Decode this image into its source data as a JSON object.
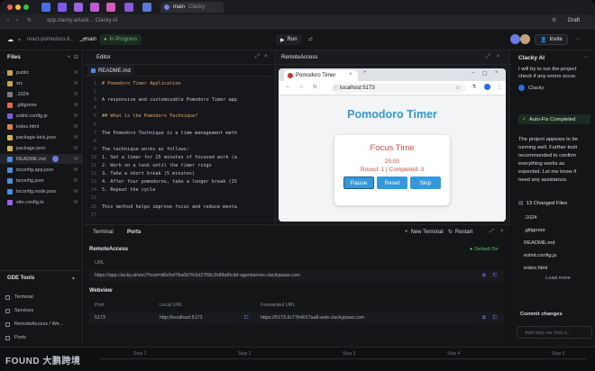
{
  "browser_chrome": {
    "active_tab": "main",
    "tab_app": "Clacky",
    "url": "app.clacky.ai/task... Clacky AI"
  },
  "header": {
    "repo": "react-pomodoro-ti...",
    "branch": "main",
    "status": "In Progress",
    "run_label": "Run",
    "invite_label": "Invite"
  },
  "files": {
    "title": "Files",
    "items": [
      {
        "name": "public",
        "badge": "M"
      },
      {
        "name": "src",
        "badge": "M"
      },
      {
        "name": ".1024",
        "badge": "M"
      },
      {
        "name": ".gitignore",
        "badge": "M"
      },
      {
        "name": "eslint.config.js",
        "badge": "M"
      },
      {
        "name": "index.html",
        "badge": "M"
      },
      {
        "name": "package-lock.json",
        "badge": "M"
      },
      {
        "name": "package.json",
        "badge": "M"
      },
      {
        "name": "README.md",
        "badge": "M"
      },
      {
        "name": "tsconfig.app.json",
        "badge": "M"
      },
      {
        "name": "tsconfig.json",
        "badge": "M"
      },
      {
        "name": "tsconfig.node.json",
        "badge": "M"
      },
      {
        "name": "vite.config.ts",
        "badge": "M"
      }
    ]
  },
  "gde_tools": {
    "title": "GDE Tools",
    "items": [
      "Terminal",
      "Services",
      "RemoteAccess / We...",
      "Ports"
    ]
  },
  "editor": {
    "title": "Editor",
    "tab": "README.md",
    "lines": [
      {
        "n": "1",
        "text": "# Pomodoro Timer Application",
        "h": true
      },
      {
        "n": "2",
        "text": "",
        "h": false
      },
      {
        "n": "3",
        "text": "A responsive and customizable Pomodoro Timer app",
        "h": false
      },
      {
        "n": "4",
        "text": "",
        "h": false
      },
      {
        "n": "5",
        "text": "## What is the Pomodoro Technique?",
        "h": true
      },
      {
        "n": "6",
        "text": "",
        "h": false
      },
      {
        "n": "7",
        "text": "The Pomodoro Technique is a time management meth",
        "h": false
      },
      {
        "n": "8",
        "text": "",
        "h": false
      },
      {
        "n": "9",
        "text": "The technique works as follows:",
        "h": false
      },
      {
        "n": "10",
        "text": "1. Set a timer for 25 minutes of focused work (a",
        "h": false
      },
      {
        "n": "11",
        "text": "2. Work on a task until the timer rings",
        "h": false
      },
      {
        "n": "12",
        "text": "3. Take a short break (5 minutes)",
        "h": false
      },
      {
        "n": "13",
        "text": "4. After four pomodoros, take a longer break (15",
        "h": false
      },
      {
        "n": "14",
        "text": "5. Repeat the cycle",
        "h": false
      },
      {
        "n": "15",
        "text": "",
        "h": false
      },
      {
        "n": "16",
        "text": "This method helps improve focus and reduce menta",
        "h": false
      },
      {
        "n": "17",
        "text": "",
        "h": false
      }
    ]
  },
  "remote": {
    "title": "RemoteAccess",
    "browser_tab": "Pomodoro Timer",
    "url": "localhost:5173",
    "page_title": "Pomodoro Timer",
    "card_title": "Focus Time",
    "time": "25:00",
    "round": "Round: 1 | Completed: 3",
    "buttons": [
      "Pause",
      "Reset",
      "Skip"
    ]
  },
  "chat": {
    "title": "Clacky AI",
    "intro": [
      "I will try to run the project",
      "check if any errors occur."
    ],
    "agent": "Clacky",
    "autofix": "Auto-Fix Completed",
    "message": [
      "The project appears to be",
      "running well. Further testi",
      "recommended to confirm",
      "everything works as",
      "expected. Let me know if",
      "need any assistance."
    ],
    "changed": "13 Changed Files",
    "changed_files": [
      ".1024",
      ".gitignore",
      "README.md",
      "eslint.config.js",
      "index.html"
    ],
    "load_more": "Load more",
    "commit": "Commit changes",
    "input_placeholder": "Add step via chat o..."
  },
  "bottom": {
    "tabs": [
      "Terminal",
      "Ports"
    ],
    "new_terminal": "New Terminal",
    "restart": "Restart",
    "remote_access": "RemoteAccess",
    "default_on": "Default On",
    "url_label": "URL",
    "remote_url": "https://app.clacky.ai/vnc/?host=d6e5ef7ba0b7fc5d2768c3/d0bd0cdd-agentserver.clackypaas.com",
    "webview": "Webview",
    "port_col": "Port",
    "local_col": "Local URL",
    "forwarded_col": "Forwarded URL",
    "port": "5173",
    "local_url": "http://localhost:5173",
    "forwarded_url": "https://5173-2c77b4017aa8-web.clackypaas.com"
  },
  "status": {
    "steps": [
      "Step 1",
      "Step 2",
      "Step 3",
      "Step 4",
      "Step 5"
    ],
    "watermark": "FOUND 大鹏跨境"
  },
  "colors": {
    "accent_blue": "#3498db",
    "focus_red": "#e74c3c",
    "status_green": "#5fbf6b"
  }
}
